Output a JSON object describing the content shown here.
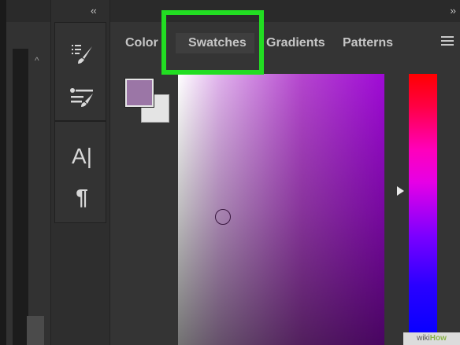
{
  "toolbar": {
    "collapse_label": "‹‹",
    "expand_label": "››",
    "text_tool_label": "A|",
    "paragraph_tool_label": "¶"
  },
  "color_panel": {
    "tabs": [
      {
        "label": "Color"
      },
      {
        "label": "Swatches"
      },
      {
        "label": "Gradients"
      },
      {
        "label": "Patterns"
      }
    ],
    "highlighted_tab": "Swatches",
    "foreground_color": "#9b76a6",
    "background_color": "#e4e4e4",
    "highlight_color": "#22dd22",
    "hue_color": "#9f0ad6"
  },
  "watermark": {
    "text_a": "wiki",
    "text_b": "How"
  }
}
